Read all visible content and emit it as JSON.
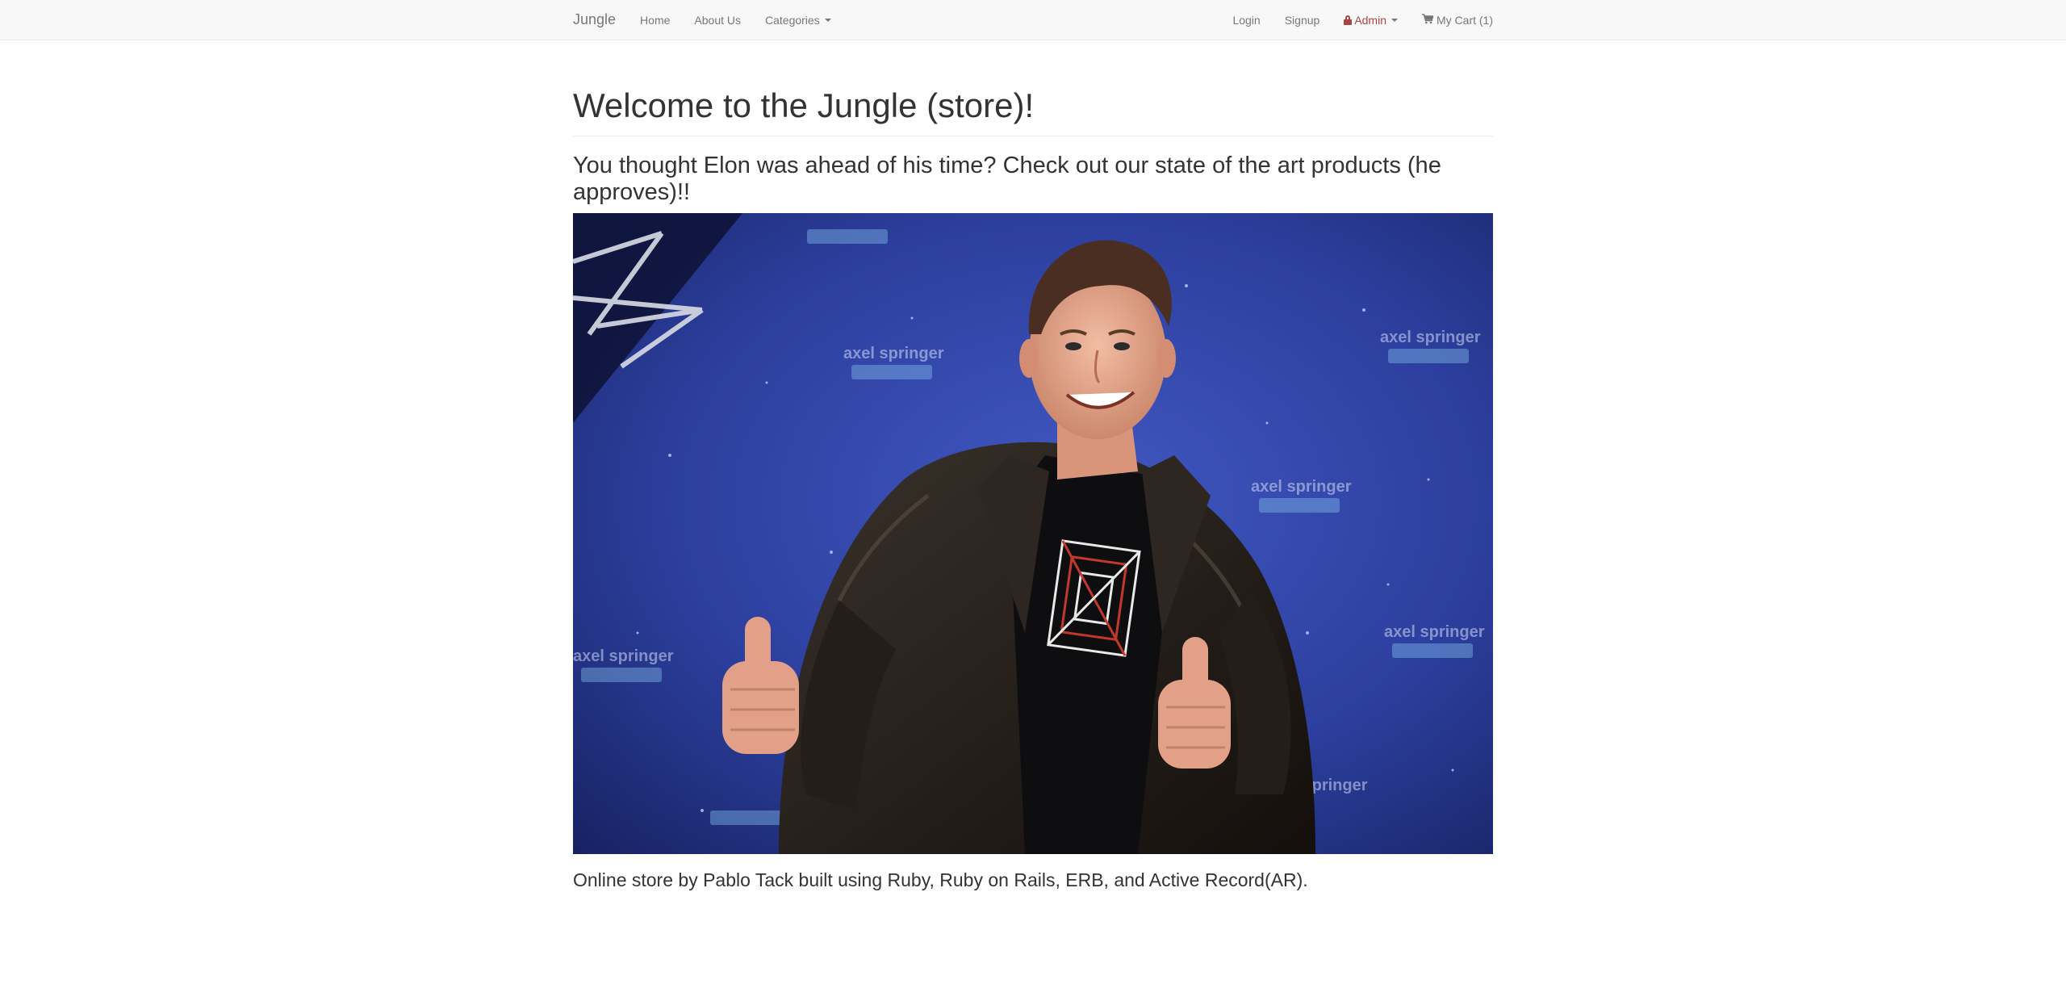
{
  "navbar": {
    "brand": "Jungle",
    "links_left": [
      {
        "label": "Home"
      },
      {
        "label": "About Us"
      },
      {
        "label": "Categories",
        "dropdown": true
      }
    ],
    "links_right": [
      {
        "label": "Login"
      },
      {
        "label": "Signup"
      },
      {
        "label": "Admin",
        "dropdown": true,
        "icon": "lock-icon",
        "color": "#a94442"
      },
      {
        "label": "My Cart (1)",
        "icon": "shopping-cart-icon"
      }
    ]
  },
  "main": {
    "title": "Welcome to the Jungle (store)!",
    "subtitle": "You thought Elon was ahead of his time? Check out our state of the art products (he approves)!!",
    "hero_image": {
      "backdrop_text": "axel springer",
      "colors": {
        "backdrop": "#2c3f9e",
        "jacket": "#1f1a16",
        "skin": "#e0a088"
      }
    },
    "footer": "Online store by Pablo Tack built using Ruby, Ruby on Rails, ERB, and Active Record(AR)."
  }
}
